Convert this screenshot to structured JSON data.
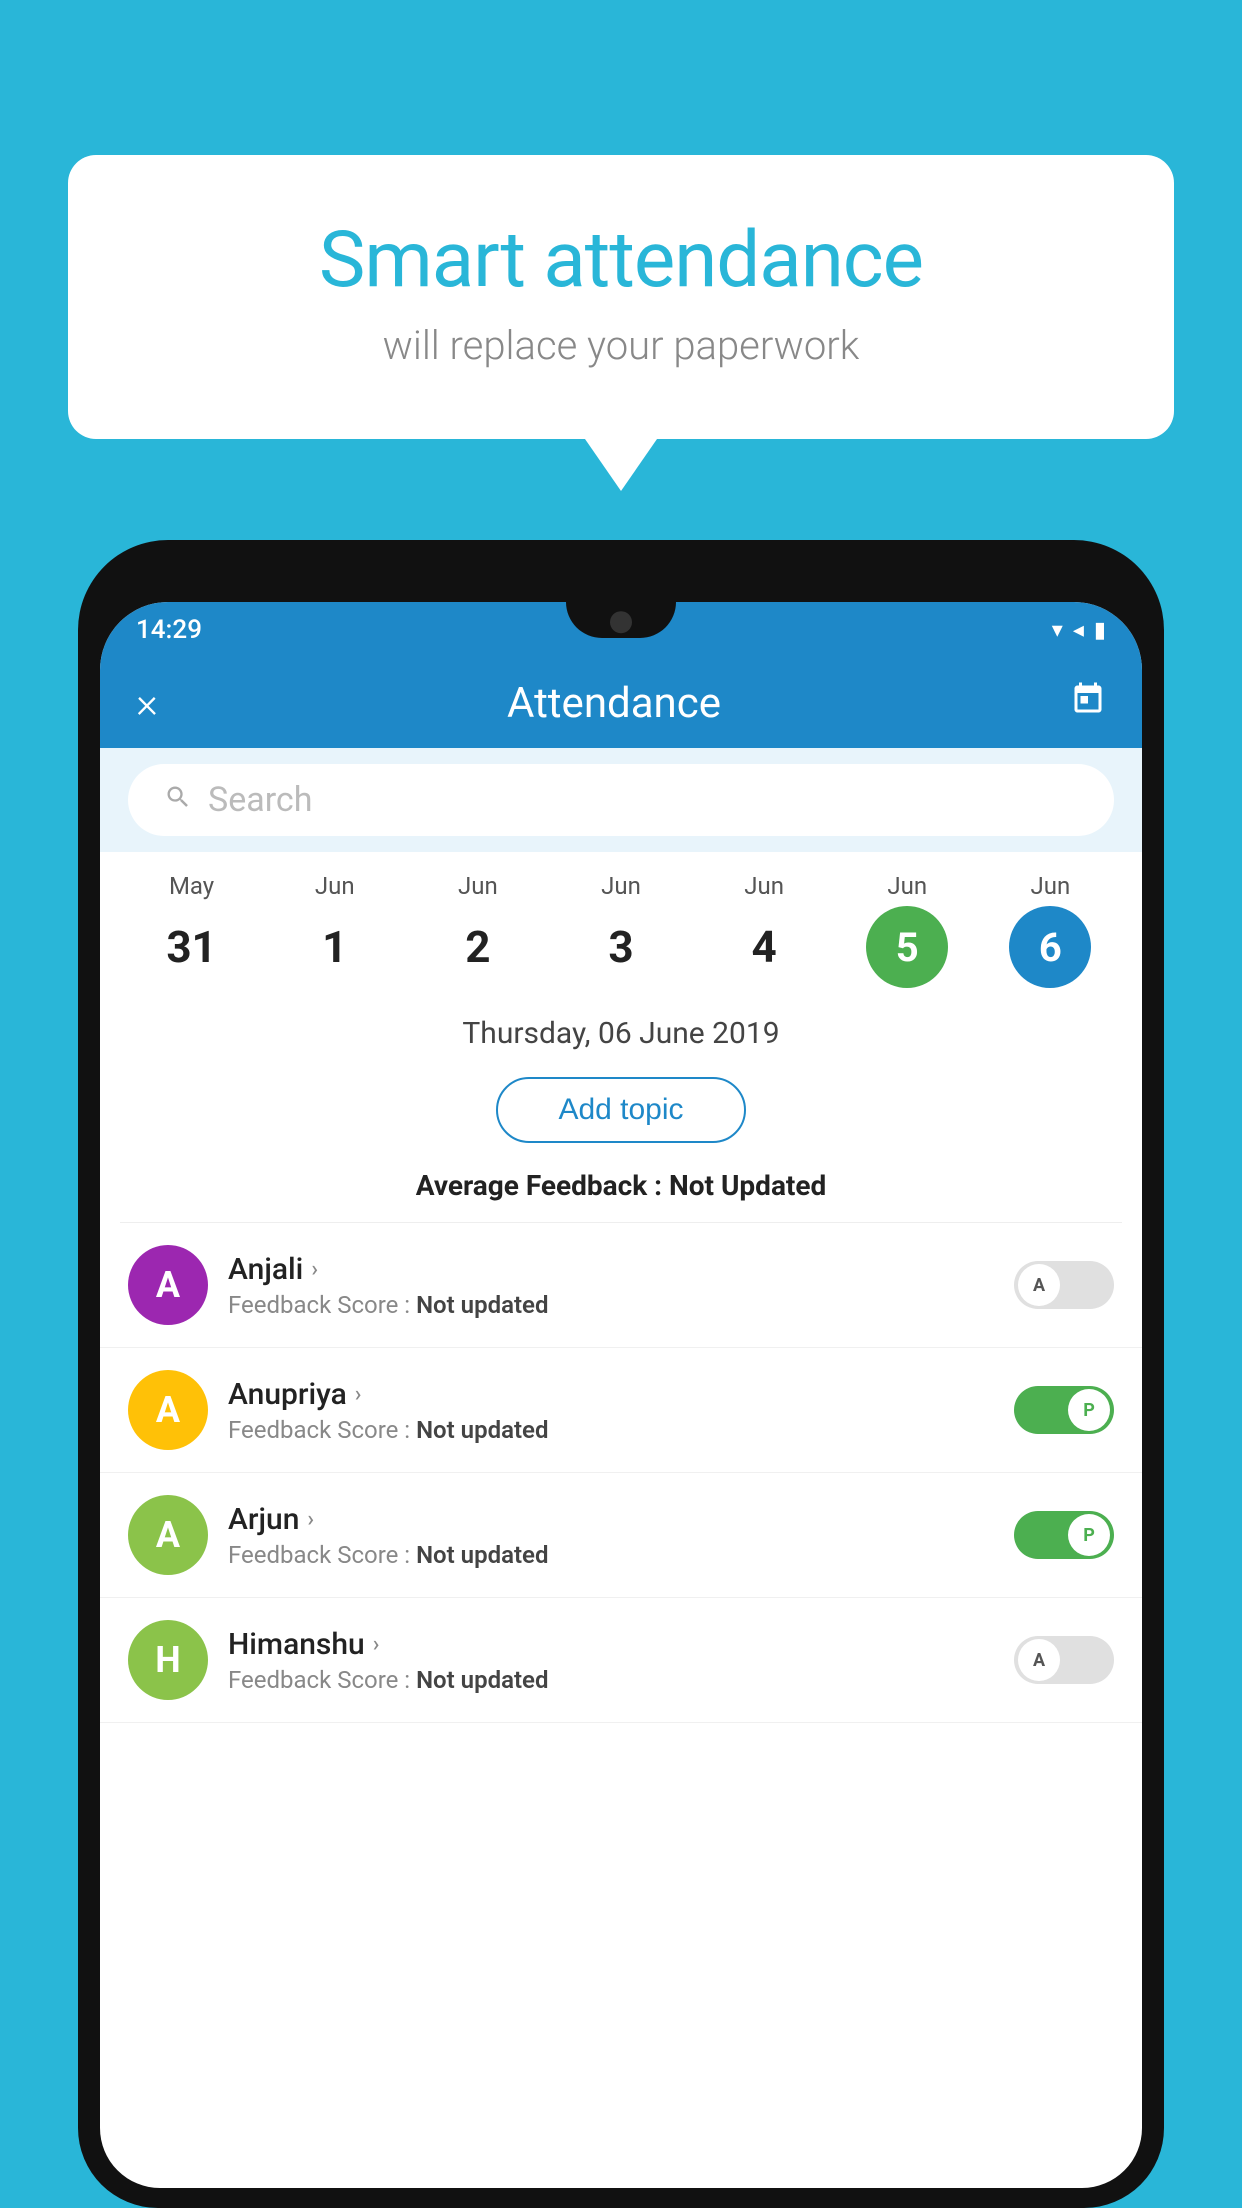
{
  "background_color": "#29B6D8",
  "speech_bubble": {
    "title": "Smart attendance",
    "subtitle": "will replace your paperwork"
  },
  "status_bar": {
    "time": "14:29",
    "wifi_icon": "▼",
    "signal_icon": "▲",
    "battery_icon": "▮"
  },
  "app_header": {
    "close_label": "×",
    "title": "Attendance",
    "calendar_icon": "📅"
  },
  "search": {
    "placeholder": "Search"
  },
  "calendar": {
    "days": [
      {
        "month": "May",
        "date": "31",
        "state": "normal"
      },
      {
        "month": "Jun",
        "date": "1",
        "state": "normal"
      },
      {
        "month": "Jun",
        "date": "2",
        "state": "normal"
      },
      {
        "month": "Jun",
        "date": "3",
        "state": "normal"
      },
      {
        "month": "Jun",
        "date": "4",
        "state": "normal"
      },
      {
        "month": "Jun",
        "date": "5",
        "state": "today"
      },
      {
        "month": "Jun",
        "date": "6",
        "state": "selected"
      }
    ]
  },
  "selected_date": "Thursday, 06 June 2019",
  "add_topic_label": "Add topic",
  "avg_feedback_label": "Average Feedback :",
  "avg_feedback_value": "Not Updated",
  "students": [
    {
      "name": "Anjali",
      "initial": "A",
      "avatar_color": "#9C27B0",
      "feedback_label": "Feedback Score :",
      "feedback_value": "Not updated",
      "toggle": "off",
      "toggle_label": "A"
    },
    {
      "name": "Anupriya",
      "initial": "A",
      "avatar_color": "#FFC107",
      "feedback_label": "Feedback Score :",
      "feedback_value": "Not updated",
      "toggle": "on",
      "toggle_label": "P"
    },
    {
      "name": "Arjun",
      "initial": "A",
      "avatar_color": "#8BC34A",
      "feedback_label": "Feedback Score :",
      "feedback_value": "Not updated",
      "toggle": "on",
      "toggle_label": "P"
    },
    {
      "name": "Himanshu",
      "initial": "H",
      "avatar_color": "#8BC34A",
      "feedback_label": "Feedback Score :",
      "feedback_value": "Not updated",
      "toggle": "off",
      "toggle_label": "A"
    }
  ]
}
